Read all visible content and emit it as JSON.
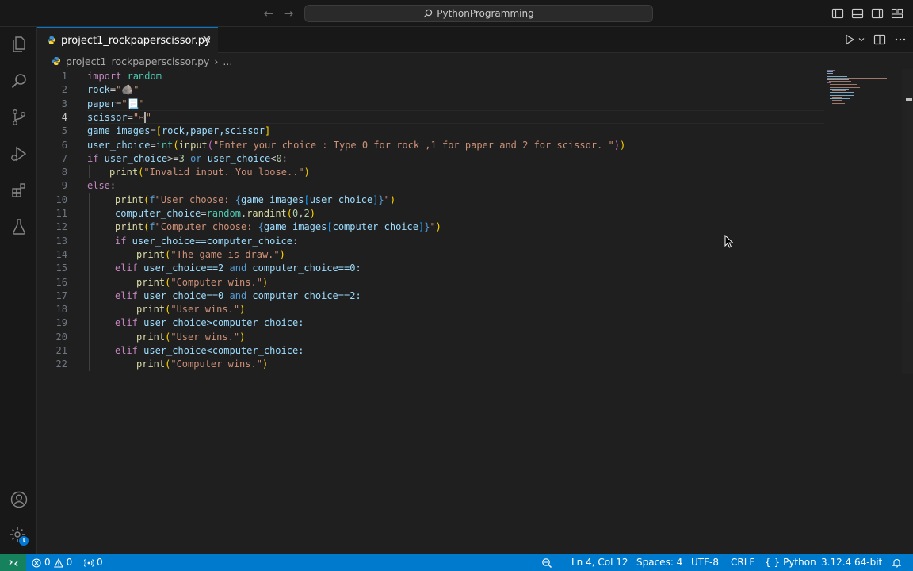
{
  "titlebar": {
    "search_text": "PythonProgramming"
  },
  "tab": {
    "filename": "project1_rockpaperscissor.py"
  },
  "breadcrumb": {
    "file": "project1_rockpaperscissor.py",
    "separator": "›",
    "more": "..."
  },
  "code": {
    "line_numbers": [
      "1",
      "2",
      "3",
      "4",
      "5",
      "6",
      "7",
      "8",
      "9",
      "10",
      "11",
      "12",
      "13",
      "14",
      "15",
      "16",
      "17",
      "18",
      "19",
      "20",
      "21",
      "22"
    ],
    "l1": {
      "kw": "import",
      "mod": " random"
    },
    "l2": {
      "var": "rock",
      "eq": "=",
      "str": "\"🪨\""
    },
    "l3": {
      "var": "paper",
      "eq": "=",
      "str": "\"📃\""
    },
    "l4": {
      "var": "scissor",
      "eq": "=",
      "str_open": "\"✂",
      "str_close": "\""
    },
    "l5": {
      "var": "game_images",
      "eq": "=",
      "lb": "[",
      "items": "rock,paper,scissor",
      "rb": "]"
    },
    "l6": {
      "var": "user_choice",
      "eq": "=",
      "fn1": "int",
      "p1": "(",
      "fn2": "input",
      "p2": "(",
      "str": "\"Enter your choice : Type 0 for rock ,1 for paper and 2 for scissor. \"",
      "p2c": ")",
      "p1c": ")"
    },
    "l7": {
      "kw": "if",
      "var1": " user_choice",
      "op1": ">=",
      "n1": "3",
      "or": " or",
      "var2": " user_choice",
      "op2": "<",
      "n2": "0",
      "colon": ":"
    },
    "l8": {
      "indent": "    ",
      "fn": "print",
      "p": "(",
      "str": "\"Invalid input. You loose..\"",
      "pc": ")"
    },
    "l9": {
      "kw": "else",
      "colon": ":"
    },
    "l10": {
      "indent": "    ",
      "fn": "print",
      "p": "(",
      "f": "f",
      "str1": "\"User choose: ",
      "b1": "{",
      "var": "game_images",
      "lb": "[",
      "idx": "user_choice",
      "rb": "]",
      "b2": "}",
      "str2": "\"",
      "pc": ")"
    },
    "l11": {
      "indent": "    ",
      "var": "computer_choice",
      "eq": "=",
      "mod": "random",
      "dot": ".",
      "fn": "randint",
      "p": "(",
      "n1": "0",
      "comma": ",",
      "n2": "2",
      "pc": ")"
    },
    "l12": {
      "indent": "    ",
      "fn": "print",
      "p": "(",
      "f": "f",
      "str1": "\"Computer choose: ",
      "b1": "{",
      "var": "game_images",
      "lb": "[",
      "idx": "computer_choice",
      "rb": "]",
      "b2": "}",
      "str2": "\"",
      "pc": ")"
    },
    "l13": {
      "indent": "    ",
      "kw": "if",
      "rest": " user_choice==computer_choice:"
    },
    "l14": {
      "indent": "        ",
      "fn": "print",
      "p": "(",
      "str": "\"The game is draw.\"",
      "pc": ")"
    },
    "l15": {
      "indent": "    ",
      "kw": "elif",
      "rest1": " user_choice==2 ",
      "and": "and",
      "rest2": " computer_choice==0:"
    },
    "l16": {
      "indent": "        ",
      "fn": "print",
      "p": "(",
      "str": "\"Computer wins.\"",
      "pc": ")"
    },
    "l17": {
      "indent": "    ",
      "kw": "elif",
      "rest1": " user_choice==0 ",
      "and": "and",
      "rest2": " computer_choice==2:"
    },
    "l18": {
      "indent": "        ",
      "fn": "print",
      "p": "(",
      "str": "\"User wins.\"",
      "pc": ")"
    },
    "l19": {
      "indent": "    ",
      "kw": "elif",
      "rest": " user_choice>computer_choice:"
    },
    "l20": {
      "indent": "        ",
      "fn": "print",
      "p": "(",
      "str": "\"User wins.\"",
      "pc": ")"
    },
    "l21": {
      "indent": "    ",
      "kw": "elif",
      "rest": " user_choice<computer_choice:"
    },
    "l22": {
      "indent": "        ",
      "fn": "print",
      "p": "(",
      "str": "\"Computer wins.\"",
      "pc": ")"
    }
  },
  "statusbar": {
    "errors": "0",
    "warnings": "0",
    "ports": "0",
    "position": "Ln 4, Col 12",
    "spaces": "Spaces: 4",
    "encoding": "UTF-8",
    "eol": "CRLF",
    "language_braces": "{ }",
    "language": "Python",
    "interpreter": "3.12.4 64-bit"
  },
  "colors": {
    "status_bar": "#007acc",
    "remote": "#16825d",
    "tab_accent": "#0078d4"
  },
  "icons": [
    "explorer-icon",
    "search-icon",
    "source-control-icon",
    "run-debug-icon",
    "extensions-icon",
    "testing-icon",
    "accounts-icon",
    "settings-gear-icon",
    "run-icon",
    "split-editor-icon",
    "more-icon",
    "zoom-icon",
    "bell-icon"
  ]
}
